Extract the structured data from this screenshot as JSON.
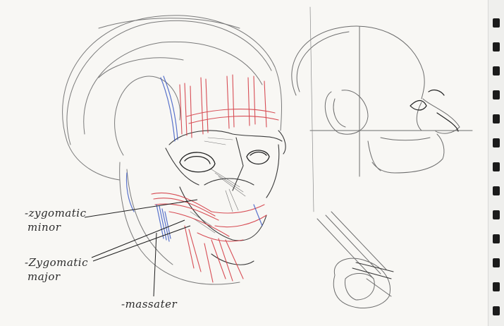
{
  "labels": {
    "zygomatic_minor": {
      "line1": "-zygomatic",
      "line2": "minor"
    },
    "zygomatic_major": {
      "line1": "-Zygomatic",
      "line2": "major"
    },
    "masseter": "-massater"
  },
  "colors": {
    "paper": "#f8f7f4",
    "pencil": "#6d6d6d",
    "dark_pencil": "#2b2b2b",
    "red_pencil": "#d2303a",
    "blue_pencil": "#3d5bc4"
  }
}
